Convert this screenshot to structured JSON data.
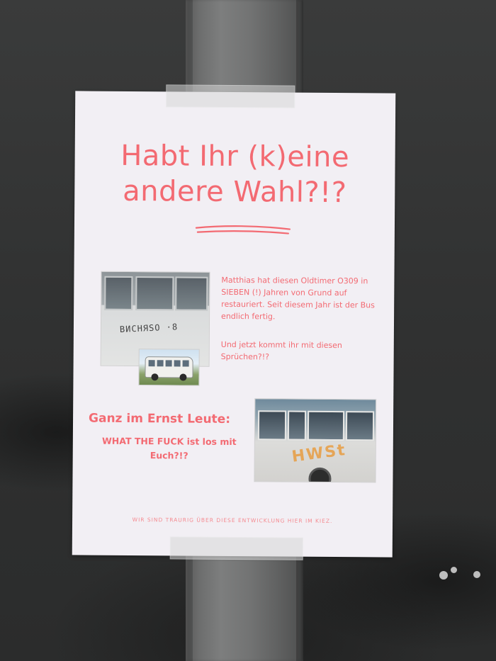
{
  "scene": {
    "wall_color": "#2f3030",
    "pole_color": "#727373",
    "paper_color": "#f2eff4",
    "accent_color": "#f36a72"
  },
  "poster": {
    "title_line1": "Habt Ihr (k)eine",
    "title_line2": "andere Wahl?!?",
    "paragraph1": "Matthias hat diesen Oldtimer O309 in SIEBEN (!)  Jahren von Grund auf restauriert. Seit diesem Jahr ist der Bus endlich fertig.",
    "paragraph2": "Und jetzt kommt ihr mit diesen Sprüchen?!?",
    "ernst_heading": "Ganz im Ernst Leute:",
    "wtf_line1": "WHAT THE FUCK ist los mit",
    "wtf_line2": "Euch?!?",
    "footer": "WIR SIND TRAURIG ÜBER DIESE ENTWICKLUNG HIER IM KIEZ."
  },
  "photos": {
    "photo1_graffiti": "ВИСНЯSО ·8",
    "photo3_graffiti": "HWSt"
  }
}
